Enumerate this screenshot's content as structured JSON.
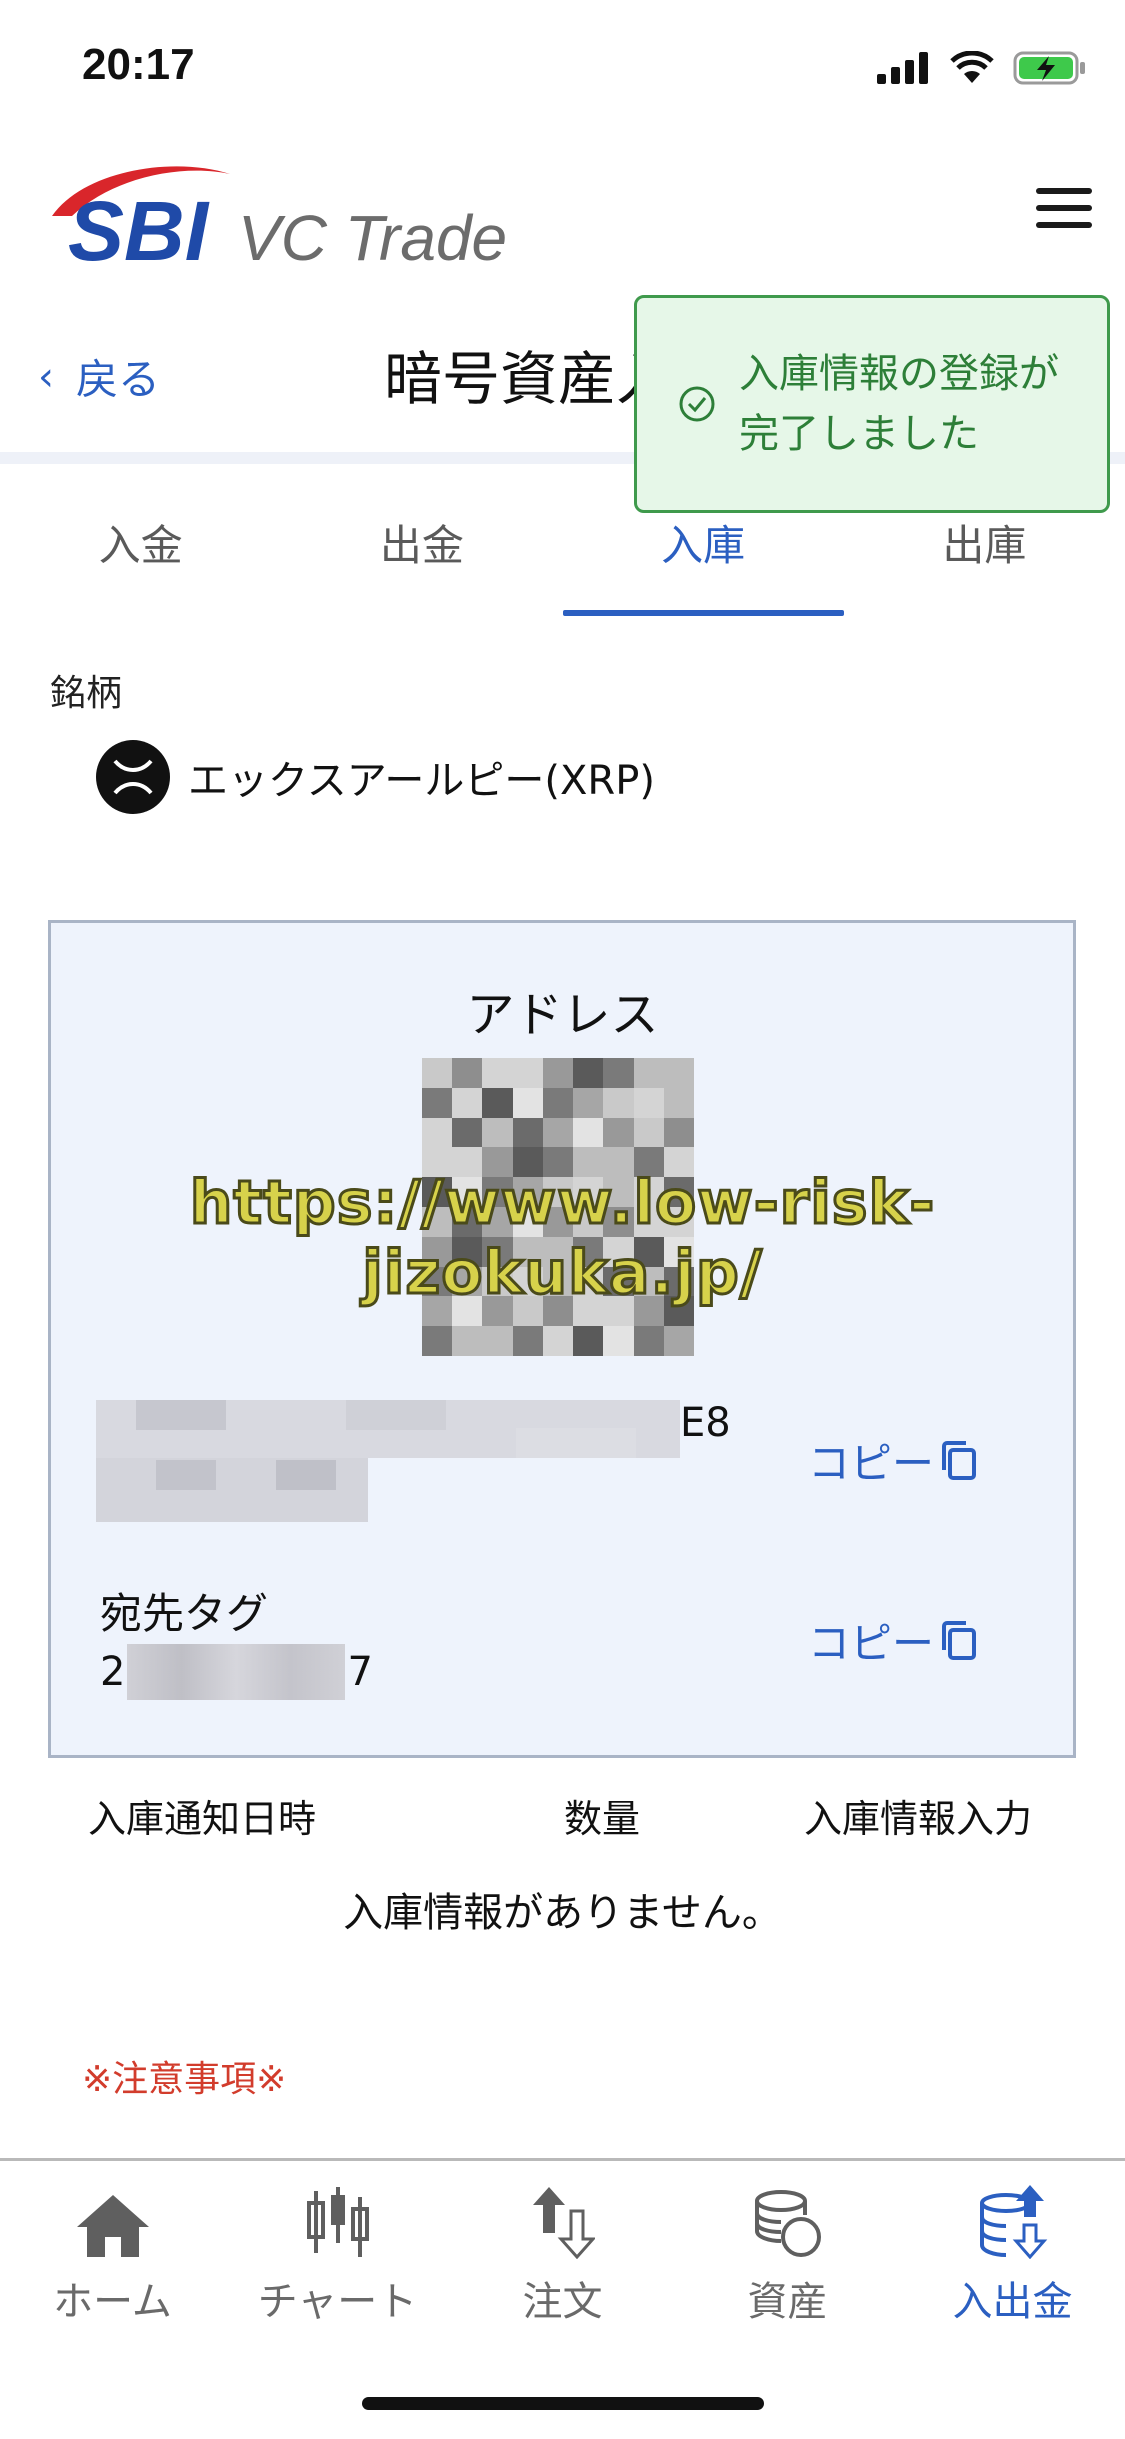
{
  "status_bar": {
    "time": "20:17"
  },
  "header": {
    "brand_sbi": "SBI",
    "brand_name": "VC Trade",
    "back_label": "戻る",
    "page_title": "暗号資産入",
    "menu_icon": "hamburger-icon"
  },
  "toast": {
    "line1": "入庫情報の登録が",
    "line2": "完了しました",
    "icon": "check-circle-icon"
  },
  "tabs": [
    {
      "label": "入金",
      "active": false
    },
    {
      "label": "出金",
      "active": false
    },
    {
      "label": "入庫",
      "active": true
    },
    {
      "label": "出庫",
      "active": false
    }
  ],
  "brand_section": {
    "label": "銘柄",
    "coin_name": "エックスアールピー(XRP)",
    "coin_icon": "xrp-icon"
  },
  "address_panel": {
    "title": "アドレス",
    "address_suffix": "E8",
    "copy_label": "コピー",
    "tag_label": "宛先タグ",
    "tag_prefix": "2",
    "tag_suffix": "7"
  },
  "watermark": "https://www.low-risk-jizokuka.jp/",
  "history": {
    "col_date": "入庫通知日時",
    "col_amount": "数量",
    "col_input": "入庫情報入力",
    "empty_message": "入庫情報がありません。"
  },
  "notice": "※注意事項※",
  "bottom_nav": [
    {
      "label": "ホーム",
      "icon": "home-icon",
      "active": false
    },
    {
      "label": "チャート",
      "icon": "candlestick-chart-icon",
      "active": false
    },
    {
      "label": "注文",
      "icon": "order-arrows-icon",
      "active": false
    },
    {
      "label": "資産",
      "icon": "coins-icon",
      "active": false
    },
    {
      "label": "入出金",
      "icon": "deposit-withdraw-icon",
      "active": true
    }
  ],
  "colors": {
    "accent": "#2b5fc1",
    "success_bg": "#e6f7e8",
    "success_text": "#2d7f38",
    "notice": "#d23c2c"
  }
}
